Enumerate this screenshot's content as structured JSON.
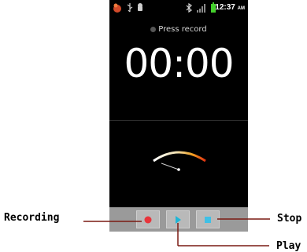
{
  "status_bar": {
    "time": "12:37",
    "ampm": "AM"
  },
  "recorder": {
    "status_text": "Press record",
    "timer": "00:00"
  },
  "controls": {
    "record_icon": "record-dot-icon",
    "play_icon": "play-triangle-icon",
    "stop_icon": "stop-square-icon"
  },
  "annotations": {
    "recording": "Recording",
    "stop": "Stop",
    "play": "Play"
  },
  "colors": {
    "record": "#e8343b",
    "play": "#1fb6d6",
    "stop": "#3fc0e6",
    "annotation_line": "#7a1a12"
  }
}
